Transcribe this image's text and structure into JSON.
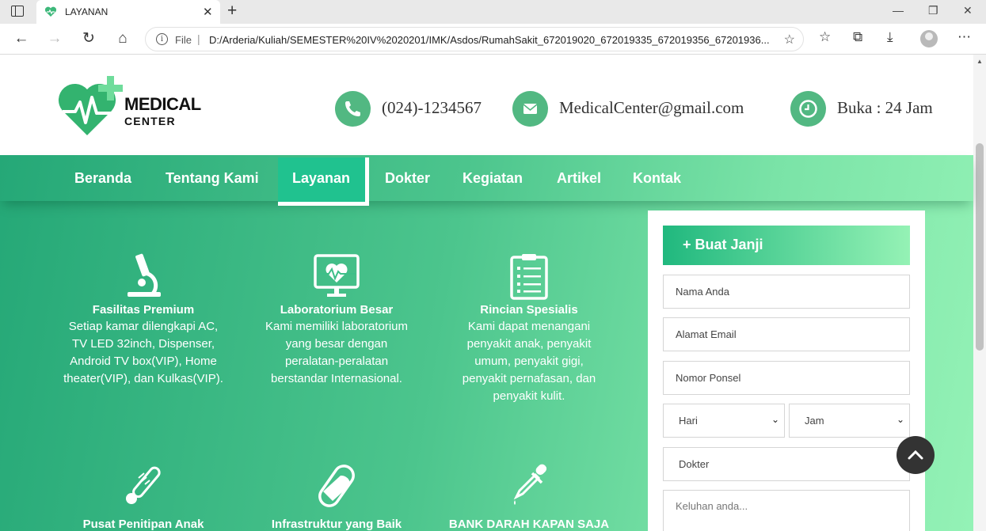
{
  "browser": {
    "tab_title": "LAYANAN",
    "file_label": "File",
    "url": "D:/Arderia/Kuliah/SEMESTER%20IV%2020201/IMK/Asdos/RumahSakit_672019020_672019335_672019356_67201936..."
  },
  "header": {
    "logo_line1": "MEDICAL",
    "logo_line2": "CENTER",
    "phone": "(024)-1234567",
    "email": "MedicalCenter@gmail.com",
    "hours": "Buka : 24 Jam"
  },
  "nav": {
    "items": [
      "Beranda",
      "Tentang Kami",
      "Layanan",
      "Dokter",
      "Kegiatan",
      "Artikel",
      "Kontak"
    ],
    "active": "Layanan"
  },
  "features": [
    {
      "title": "Fasilitas Premium",
      "lines": [
        "Setiap kamar dilengkapi AC,",
        "TV LED 32inch, Dispenser,",
        "Android TV box(VIP), Home",
        "theater(VIP), dan Kulkas(VIP)."
      ],
      "icon": "microscope-icon"
    },
    {
      "title": "Laboratorium Besar",
      "lines": [
        "Kami memiliki laboratorium",
        "yang besar dengan",
        "peralatan-peralatan",
        "berstandar Internasional."
      ],
      "icon": "monitor-heartbeat-icon"
    },
    {
      "title": "Rincian Spesialis",
      "lines": [
        "Kami dapat menangani",
        "penyakit anak, penyakit",
        "umum, penyakit gigi,",
        "penyakit pernafasan, dan",
        "penyakit kulit."
      ],
      "icon": "clipboard-icon"
    },
    {
      "title": "Pusat Penitipan Anak",
      "lines": [],
      "icon": "thermometer-icon"
    },
    {
      "title": "Infrastruktur yang Baik",
      "lines": [],
      "icon": "pill-icon"
    },
    {
      "title": "BANK DARAH KAPAN SAJA",
      "lines": [],
      "icon": "dropper-icon"
    }
  ],
  "form": {
    "title": "+ Buat Janji",
    "name_placeholder": "Nama Anda",
    "email_placeholder": "Alamat Email",
    "phone_placeholder": "Nomor Ponsel",
    "day_select": "Hari",
    "time_select": "Jam",
    "doctor_placeholder": "Dokter",
    "message_placeholder": "Keluhan anda..."
  },
  "colors": {
    "primary_green": "#52b882",
    "active_nav": "#20c28f"
  }
}
